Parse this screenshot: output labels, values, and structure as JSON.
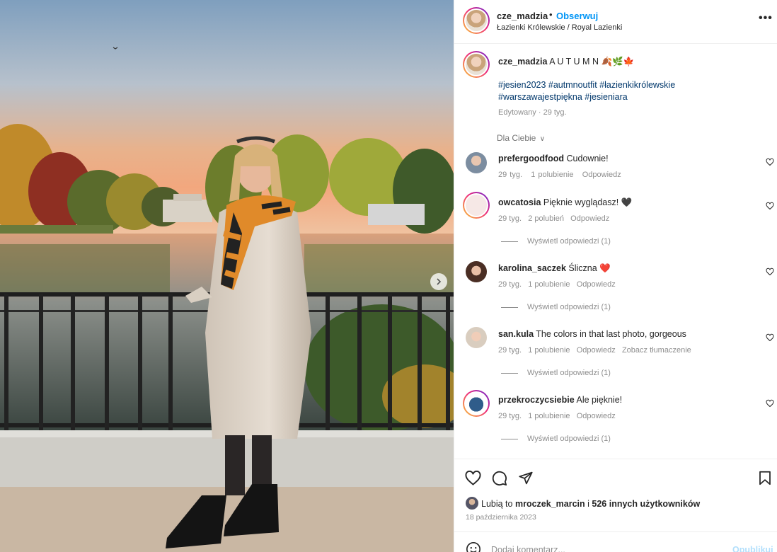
{
  "post": {
    "username": "cze_madzia",
    "separator": "•",
    "follow_label": "Obserwuj",
    "location": "Łazienki Królewskie / Royal Lazienki",
    "more_icon": "more-options-icon",
    "caption_text": "A U T U M N 🍂🌿🍁",
    "hashtags_line1": "#jesien2023 #autmnoutfit #łazienkikrólewskie",
    "hashtags_line2": "#warszawajestpiękna #jesieniara",
    "edited_meta": "Edytowany · 29 tyg.",
    "filter_label": "Dla Ciebie",
    "filter_chevron": "∨"
  },
  "comments": [
    {
      "user": "prefergoodfood",
      "text": "Cudownie!",
      "time": "29 tyg.",
      "likes": "1 polubienie",
      "reply": "Odpowiedz",
      "translate": "",
      "view_replies": ""
    },
    {
      "user": "owcatosia",
      "text": "Pięknie wyglądasz! 🖤",
      "time": "29 tyg.",
      "likes": "2 polubień",
      "reply": "Odpowiedz",
      "translate": "",
      "view_replies": "Wyświetl odpowiedzi (1)"
    },
    {
      "user": "karolina_saczek",
      "text": "Śliczna ❤️",
      "time": "29 tyg.",
      "likes": "1 polubienie",
      "reply": "Odpowiedz",
      "translate": "",
      "view_replies": "Wyświetl odpowiedzi (1)"
    },
    {
      "user": "san.kula",
      "text": "The colors in that last photo, gorgeous",
      "time": "29 tyg.",
      "likes": "1 polubienie",
      "reply": "Odpowiedz",
      "translate": "Zobacz tłumaczenie",
      "view_replies": "Wyświetl odpowiedzi (1)"
    },
    {
      "user": "przekroczycsiebie",
      "text": "Ale pięknie!",
      "time": "29 tyg.",
      "likes": "1 polubienie",
      "reply": "Odpowiedz",
      "translate": "",
      "view_replies": "Wyświetl odpowiedzi (1)"
    }
  ],
  "actions": {
    "like_icon": "heart-icon",
    "comment_icon": "comment-icon",
    "share_icon": "share-icon",
    "save_icon": "bookmark-icon",
    "likes_prefix": "Lubią to",
    "likes_user": "mroczek_marcin",
    "likes_middle": "i",
    "likes_others": "526 innych użytkowników",
    "date": "18 października 2023"
  },
  "comment_bar": {
    "emoji_icon": "emoji-icon",
    "placeholder": "Dodaj komentarz...",
    "post_label": "Opublikuj"
  },
  "colors": {
    "link_blue": "#0095f6",
    "hashtag_blue": "#00376b",
    "muted": "#8e8e8e",
    "heart_red": "#ed4956"
  }
}
